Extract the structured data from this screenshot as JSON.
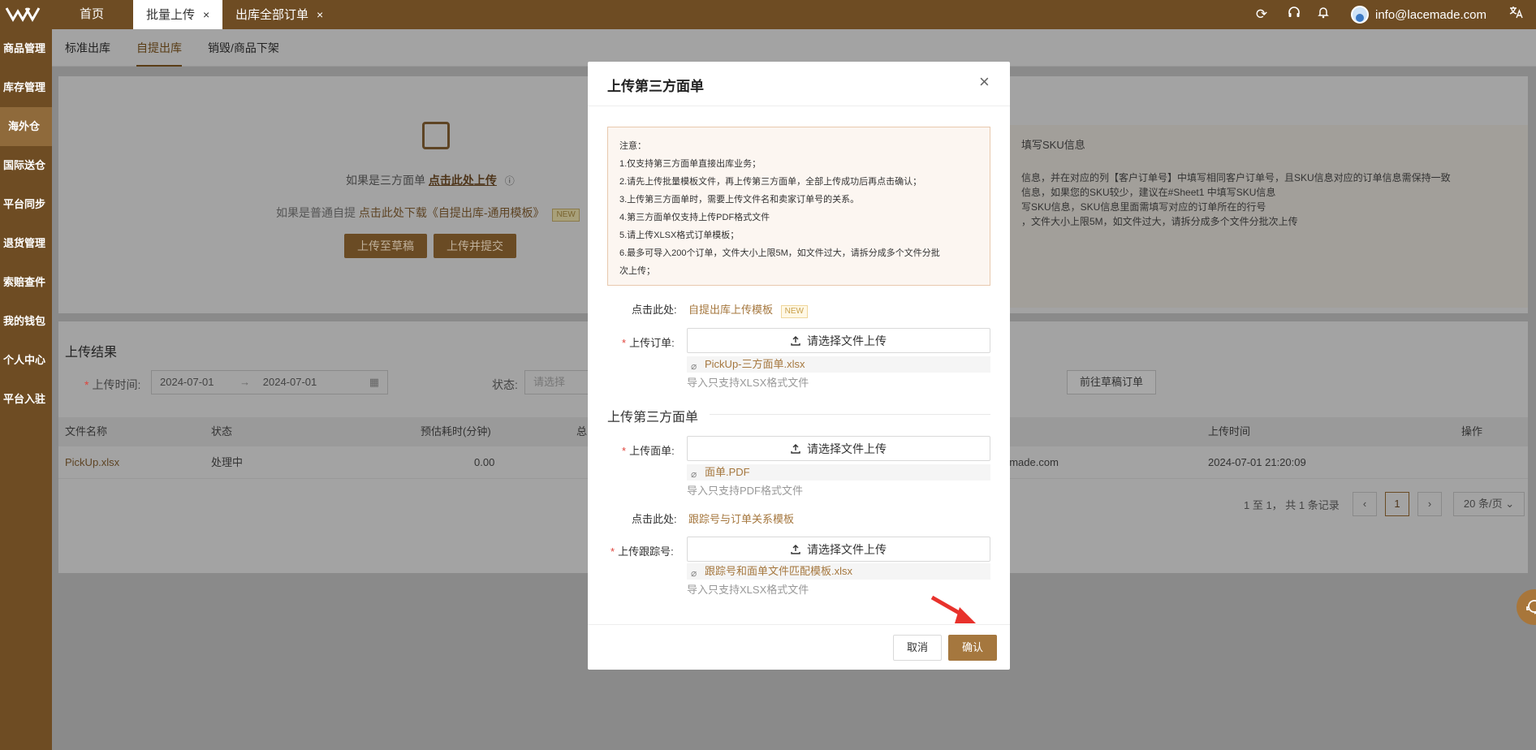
{
  "topbar": {
    "tabs": [
      {
        "label": "首页",
        "closable": false,
        "active": false
      },
      {
        "label": "批量上传",
        "closable": true,
        "active": true
      },
      {
        "label": "出库全部订单",
        "closable": true,
        "active": false
      }
    ],
    "user_email": "info@lacemade.com",
    "icons": [
      "refresh-icon",
      "headset-icon",
      "bell-icon",
      "translate-icon"
    ]
  },
  "sidebar": {
    "items": [
      {
        "label": "商品管理"
      },
      {
        "label": "库存管理"
      },
      {
        "label": "海外仓",
        "active": true
      },
      {
        "label": "国际送仓"
      },
      {
        "label": "平台同步"
      },
      {
        "label": "退货管理"
      },
      {
        "label": "索赔查件"
      },
      {
        "label": "我的钱包"
      },
      {
        "label": "个人中心"
      },
      {
        "label": "平台入驻"
      }
    ]
  },
  "subtabs": [
    "标准出库",
    "自提出库",
    "销毁/商品下架"
  ],
  "bg": {
    "third_party_text": "如果是三方面单",
    "third_party_link": "点击此处上传",
    "normal_text": "如果是普通自提",
    "normal_link": "点击此处下载《自提出库-通用模板》",
    "new_tag": "NEW",
    "btn_draft": "上传至草稿",
    "btn_submit": "上传并提交",
    "instr_title": "填写SKU信息",
    "instr_lines": [
      "信息，并在对应的列【客户订单号】中填写相同客户订单号，且SKU信息对应的订单信息需保持一致",
      "信息，如果您的SKU较少，建议在#Sheet1 中填写SKU信息",
      "写SKU信息，SKU信息里面需填写对应的订单所在的行号",
      "，文件大小上限5M，如文件过大，请拆分成多个文件分批次上传"
    ],
    "results_title": "上传结果",
    "upload_time_label": "上传时间:",
    "date_from": "2024-07-01",
    "date_to": "2024-07-01",
    "status_label": "状态:",
    "status_placeholder": "请选择",
    "draft_orders_btn": "前往草稿订单",
    "columns": [
      "文件名称",
      "状态",
      "预估耗时(分钟)",
      "总",
      "上传时间",
      "操作"
    ],
    "row": {
      "file": "PickUp.xlsx",
      "status": "处理中",
      "eta": "0.00",
      "user": "emade.com",
      "time": "2024-07-01 21:20:09"
    },
    "pagination_text": "1 至 1， 共 1 条记录",
    "page": "1",
    "page_size": "20 条/页"
  },
  "modal": {
    "title": "上传第三方面单",
    "notice": [
      "注意：",
      "1.仅支持第三方面单直接出库业务；",
      "2.请先上传批量模板文件，再上传第三方面单，全部上传成功后再点击确认；",
      "3.上传第三方面单时，需要上传文件名和卖家订单号的关系。",
      "4.第三方面单仅支持上传PDF格式文件",
      "5.请上传XLSX格式订单模板；",
      "6.最多可导入200个订单，文件大小上限5M，如文件过大，请拆分成多个文件分批",
      "次上传；"
    ],
    "click_here": "点击此处:",
    "template_link": "自提出库上传模板",
    "new_tag": "NEW",
    "upload_order_label": "上传订单:",
    "upload_btn": "请选择文件上传",
    "order_file": "PickUp-三方面单.xlsx",
    "xlsx_hint": "导入只支持XLSX格式文件",
    "section_title": "上传第三方面单",
    "upload_label_label": "上传面单:",
    "label_file": "面单.PDF",
    "pdf_hint": "导入只支持PDF格式文件",
    "click_here2": "点击此处:",
    "tracking_template_link": "跟踪号与订单关系模板",
    "upload_tracking_label": "上传跟踪号:",
    "tracking_file": "跟踪号和面单文件匹配模板.xlsx",
    "xlsx_hint2": "导入只支持XLSX格式文件",
    "cancel": "取消",
    "confirm": "确认"
  },
  "colors": {
    "brand": "#6e4c23",
    "accent": "#a5773e",
    "required": "#e0443c",
    "arrow": "#e8322c"
  }
}
